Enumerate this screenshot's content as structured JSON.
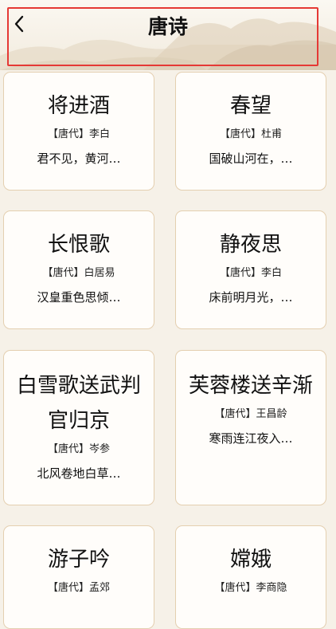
{
  "header": {
    "title": "唐诗",
    "back_icon": "chevron-left-icon"
  },
  "poems": [
    {
      "title": "将进酒",
      "author": "【唐代】李白",
      "excerpt": "君不见，黄河…"
    },
    {
      "title": "春望",
      "author": "【唐代】杜甫",
      "excerpt": "国破山河在，…"
    },
    {
      "title": "长恨歌",
      "author": "【唐代】白居易",
      "excerpt": "汉皇重色思倾…"
    },
    {
      "title": "静夜思",
      "author": "【唐代】李白",
      "excerpt": "床前明月光，…"
    },
    {
      "title": "白雪歌送武判官归京",
      "author": "【唐代】岑参",
      "excerpt": "北风卷地白草…"
    },
    {
      "title": "芙蓉楼送辛渐",
      "author": "【唐代】王昌龄",
      "excerpt": "寒雨连江夜入…"
    },
    {
      "title": "游子吟",
      "author": "【唐代】孟郊",
      "excerpt": ""
    },
    {
      "title": "嫦娥",
      "author": "【唐代】李商隐",
      "excerpt": ""
    }
  ]
}
